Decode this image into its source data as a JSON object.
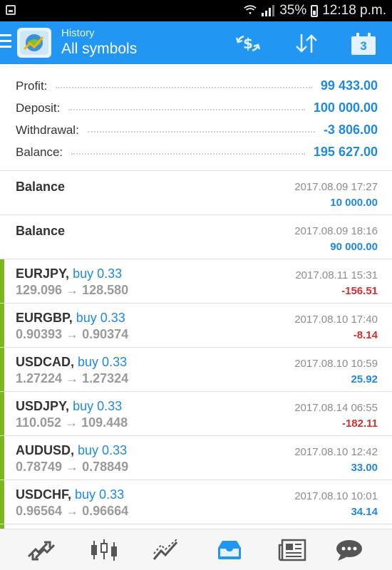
{
  "status_bar": {
    "battery": "35%",
    "time": "12:18 p.m."
  },
  "app_bar": {
    "subtitle": "History",
    "title": "All symbols",
    "calendar_day": "3",
    "accent": "#2196f3"
  },
  "summary": [
    {
      "label": "Profit:",
      "value": "99 433.00"
    },
    {
      "label": "Deposit:",
      "value": "100 000.00"
    },
    {
      "label": "Withdrawal:",
      "value": "-3 806.00"
    },
    {
      "label": "Balance:",
      "value": "195 627.00"
    }
  ],
  "balance_ops": [
    {
      "title": "Balance",
      "time": "2017.08.09 17:27",
      "amount": "10 000.00"
    },
    {
      "title": "Balance",
      "time": "2017.08.09 18:16",
      "amount": "90 000.00"
    }
  ],
  "deals": [
    {
      "symbol": "EURJPY,",
      "type": "buy 0.33",
      "prices": "129.096 → 128.580",
      "time": "2017.08.11 15:31",
      "profit": "-156.51",
      "profit_negative": true
    },
    {
      "symbol": "EURGBP,",
      "type": "buy 0.33",
      "prices": "0.90393 → 0.90374",
      "time": "2017.08.10 17:40",
      "profit": "-8.14",
      "profit_negative": true
    },
    {
      "symbol": "USDCAD,",
      "type": "buy 0.33",
      "prices": "1.27224 → 1.27324",
      "time": "2017.08.10 10:59",
      "profit": "25.92",
      "profit_negative": false
    },
    {
      "symbol": "USDJPY,",
      "type": "buy 0.33",
      "prices": "110.052 → 109.448",
      "time": "2017.08.14 06:55",
      "profit": "-182.11",
      "profit_negative": true
    },
    {
      "symbol": "AUDUSD,",
      "type": "buy 0.33",
      "prices": "0.78749 → 0.78849",
      "time": "2017.08.10 12:42",
      "profit": "33.00",
      "profit_negative": false
    },
    {
      "symbol": "USDCHF,",
      "type": "buy 0.33",
      "prices": "0.96564 → 0.96664",
      "time": "2017.08.10 10:01",
      "profit": "34.14",
      "profit_negative": false
    }
  ],
  "bottom_nav": [
    {
      "icon": "quotes-icon",
      "active": false
    },
    {
      "icon": "chart-icon",
      "active": false
    },
    {
      "icon": "trade-icon",
      "active": false
    },
    {
      "icon": "history-icon",
      "active": true
    },
    {
      "icon": "news-icon",
      "active": false
    },
    {
      "icon": "chat-icon",
      "active": false
    }
  ],
  "colors": {
    "profit_positive": "#1e88e5",
    "profit_negative": "#d32f2f",
    "buy_stripe": "#7cb51f",
    "nav_active": "#2196f3",
    "nav_inactive": "#555555"
  }
}
